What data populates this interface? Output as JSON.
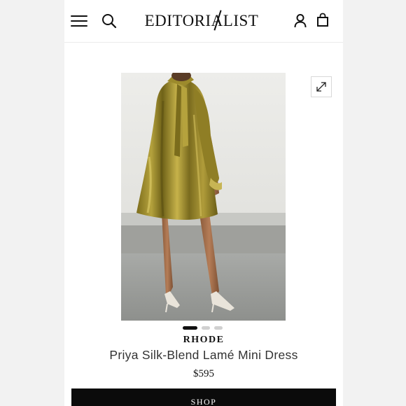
{
  "header": {
    "logo_text": "EDITORIALIST",
    "menu_icon": "hamburger-menu-icon",
    "search_icon": "search-icon",
    "account_icon": "user-icon",
    "bag_icon": "shopping-bag-icon"
  },
  "gallery": {
    "expand_icon": "expand-icon",
    "image_alt": "Woman wearing a gold metallic lamé mini dress with a neck tie, shown from behind",
    "dots": [
      {
        "active": true
      },
      {
        "active": false
      },
      {
        "active": false
      }
    ]
  },
  "product": {
    "brand": "RHODE",
    "name": "Priya Silk-Blend Lamé Mini Dress",
    "price": "$595"
  },
  "cta": {
    "shop_label": "SHOP"
  },
  "colors": {
    "accent": "#0b0b0b",
    "dress_gold": "#a2912f"
  }
}
